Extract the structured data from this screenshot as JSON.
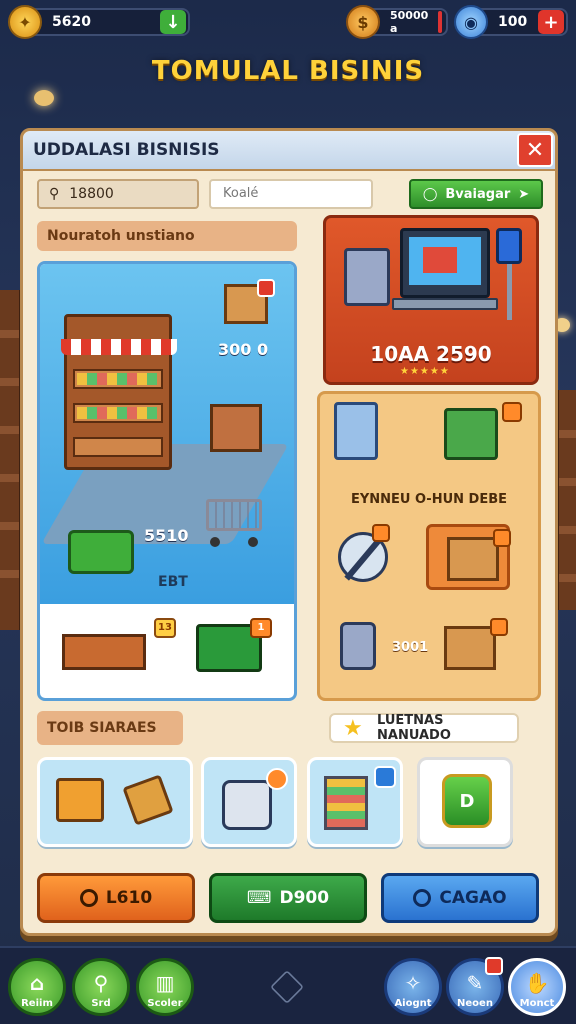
{
  "resources": {
    "gold": {
      "value": "5620",
      "icon": "gold-coin-icon"
    },
    "cash": {
      "value": "50000 a"
    },
    "gems": {
      "value": "100"
    }
  },
  "game_title": "TOMULAL BISINIS",
  "panel": {
    "title": "UDDALASI BISNISIS",
    "search_value": "18800",
    "text_field_value": "Koalé",
    "green_button": "Bvaiagar"
  },
  "left_section": {
    "header": "Nouratoh unstiano",
    "scene_values": {
      "a": "300 0",
      "b": "5510",
      "c": "EBT"
    },
    "table_badge": "13",
    "money_badge": "1"
  },
  "right_section": {
    "featured_price": "10AA 2590",
    "stars": "★★★★★",
    "heading": "EYNNEU O-HUN DEBE",
    "slot3_number": "3001"
  },
  "tools_section": {
    "header": "TOIB SIARAES",
    "pill_label": "LUETNAS NANUADO",
    "green_box_label": "D"
  },
  "actions": [
    {
      "label": "L610",
      "color": "#e0621c"
    },
    {
      "label": "D900",
      "color": "#1e7a2a"
    },
    {
      "label": "CAGAO",
      "color": "#2a72d0"
    }
  ],
  "nav": [
    {
      "label": "Reiim"
    },
    {
      "label": "Srd"
    },
    {
      "label": "Scoler"
    },
    {
      "label": "Aiognt"
    },
    {
      "label": "Neoen"
    },
    {
      "label": "Monct"
    }
  ],
  "colors": {
    "accent": "#ffd23a",
    "close": "#e0402e",
    "panel_bg": "#f6ead2"
  }
}
